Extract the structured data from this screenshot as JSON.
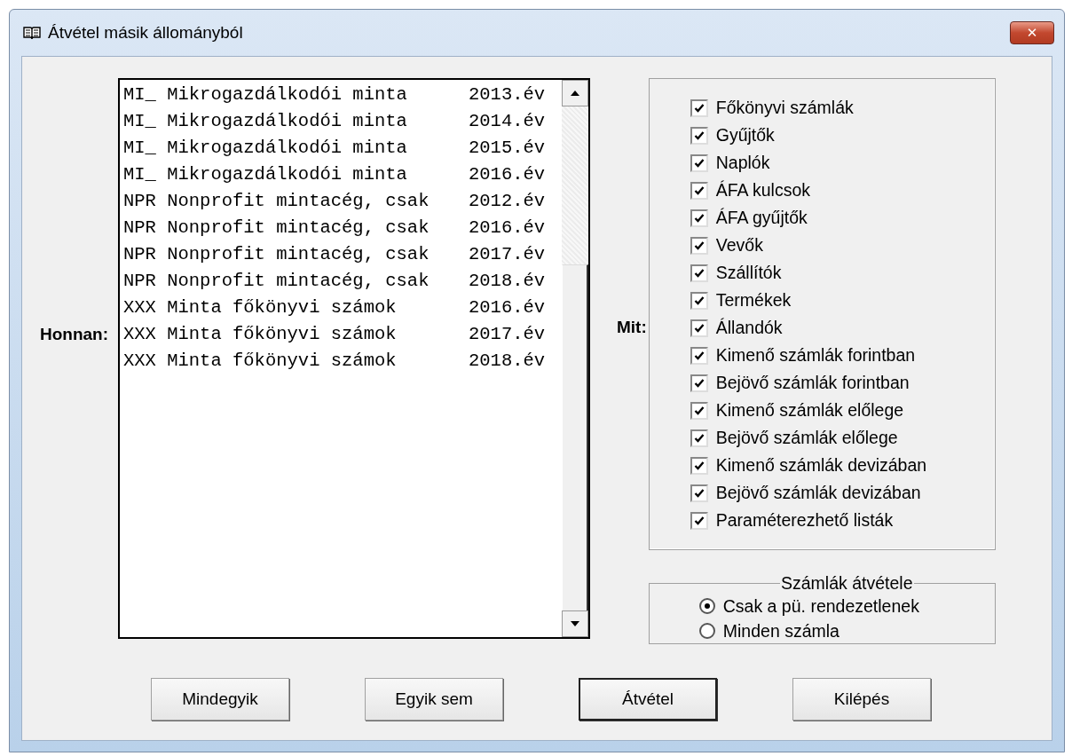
{
  "window": {
    "title": "Átvétel másik állományból",
    "close_button": "✕"
  },
  "source": {
    "label": "Honnan:",
    "rows": [
      {
        "name": "MI_ Mikrogazdálkodói minta",
        "year": "2013.év",
        "selected": false
      },
      {
        "name": "MI_ Mikrogazdálkodói minta",
        "year": "2014.év",
        "selected": false
      },
      {
        "name": "MI_ Mikrogazdálkodói minta",
        "year": "2015.év",
        "selected": false
      },
      {
        "name": "MI_ Mikrogazdálkodói minta",
        "year": "2016.év",
        "selected": false
      },
      {
        "name": "NPR Nonprofit mintacég, csak",
        "year": "2012.év",
        "selected": false
      },
      {
        "name": "NPR Nonprofit mintacég, csak",
        "year": "2016.év",
        "selected": false
      },
      {
        "name": "NPR Nonprofit mintacég, csak",
        "year": "2017.év",
        "selected": false
      },
      {
        "name": "NPR Nonprofit mintacég, csak",
        "year": "2018.év",
        "selected": false
      },
      {
        "name": "XXX Minta főkönyvi számok",
        "year": "2016.év",
        "selected": false
      },
      {
        "name": "XXX Minta főkönyvi számok",
        "year": "2017.év",
        "selected": false
      },
      {
        "name": "XXX Minta főkönyvi számok",
        "year": "2018.év",
        "selected": false
      }
    ]
  },
  "what": {
    "label": "Mit:",
    "items": [
      {
        "label": "Főkönyvi számlák",
        "checked": true
      },
      {
        "label": "Gyűjtők",
        "checked": true
      },
      {
        "label": "Naplók",
        "checked": true
      },
      {
        "label": "ÁFA kulcsok",
        "checked": true
      },
      {
        "label": "ÁFA gyűjtők",
        "checked": true
      },
      {
        "label": "Vevők",
        "checked": true
      },
      {
        "label": "Szállítók",
        "checked": true
      },
      {
        "label": "Termékek",
        "checked": true
      },
      {
        "label": "Állandók",
        "checked": true
      },
      {
        "label": "Kimenő számlák forintban",
        "checked": true
      },
      {
        "label": "Bejövő számlák forintban",
        "checked": true
      },
      {
        "label": "Kimenő számlák előlege",
        "checked": true
      },
      {
        "label": "Bejövő számlák előlege",
        "checked": true
      },
      {
        "label": "Kimenő számlák devizában",
        "checked": true
      },
      {
        "label": "Bejövő számlák devizában",
        "checked": true
      },
      {
        "label": "Paraméterezhető listák",
        "checked": true
      }
    ]
  },
  "invoices": {
    "title": "Számlák átvétele",
    "options": [
      {
        "label": "Csak a pü. rendezetlenek",
        "selected": true
      },
      {
        "label": "Minden számla",
        "selected": false
      }
    ]
  },
  "buttons": [
    {
      "label": "Mindegyik",
      "default": false
    },
    {
      "label": "Egyik sem",
      "default": false
    },
    {
      "label": "Átvétel",
      "default": true
    },
    {
      "label": "Kilépés",
      "default": false
    }
  ]
}
